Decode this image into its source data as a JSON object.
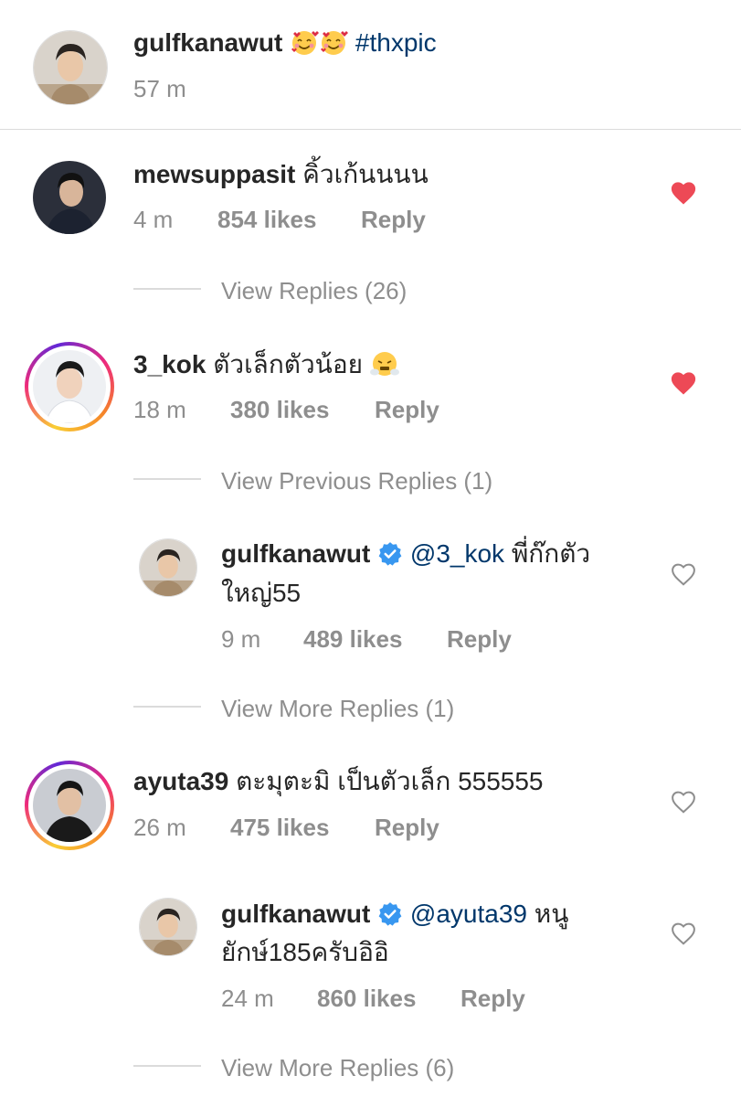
{
  "caption": {
    "username": "gulfkanawut",
    "emoji_1": "smiling-face-with-hearts",
    "emoji_2": "smiling-face-with-hearts",
    "hashtag": "#thxpic",
    "time": "57 m"
  },
  "comments": [
    {
      "username": "mewsuppasit",
      "text": "คิ้วเก้นนนน",
      "time": "4 m",
      "likes": "854 likes",
      "reply_label": "Reply",
      "liked": true,
      "view_replies": "View Replies (26)"
    },
    {
      "username": "3_kok",
      "text": "ตัวเล็กตัวน้อย",
      "emoji": "face-with-steam-from-nose",
      "time": "18 m",
      "likes": "380 likes",
      "reply_label": "Reply",
      "liked": true,
      "view_previous": "View Previous Replies (1)",
      "reply": {
        "username": "gulfkanawut",
        "mention": "@3_kok",
        "text_line1": "พี่ก๊กตัว",
        "text_line2": "ใหญ่55",
        "time": "9 m",
        "likes": "489 likes",
        "reply_label": "Reply",
        "liked": false
      },
      "view_more": "View More Replies (1)"
    },
    {
      "username": "ayuta39",
      "text": "ตะมุตะมิ เป็นตัวเล็ก 555555",
      "time": "26 m",
      "likes": "475 likes",
      "reply_label": "Reply",
      "liked": false,
      "reply": {
        "username": "gulfkanawut",
        "mention": "@ayuta39",
        "text_line1": "หนู",
        "text_line2": "ยักษ์185ครับอิอิ",
        "time": "24 m",
        "likes": "860 likes",
        "reply_label": "Reply",
        "liked": false
      },
      "view_more": "View More Replies (6)"
    }
  ],
  "colors": {
    "text": "#262626",
    "meta": "#8e8e8e",
    "link": "#00376b",
    "heart_liked": "#ed4956",
    "verified": "#3897f0",
    "divider": "#dbdbdb"
  }
}
